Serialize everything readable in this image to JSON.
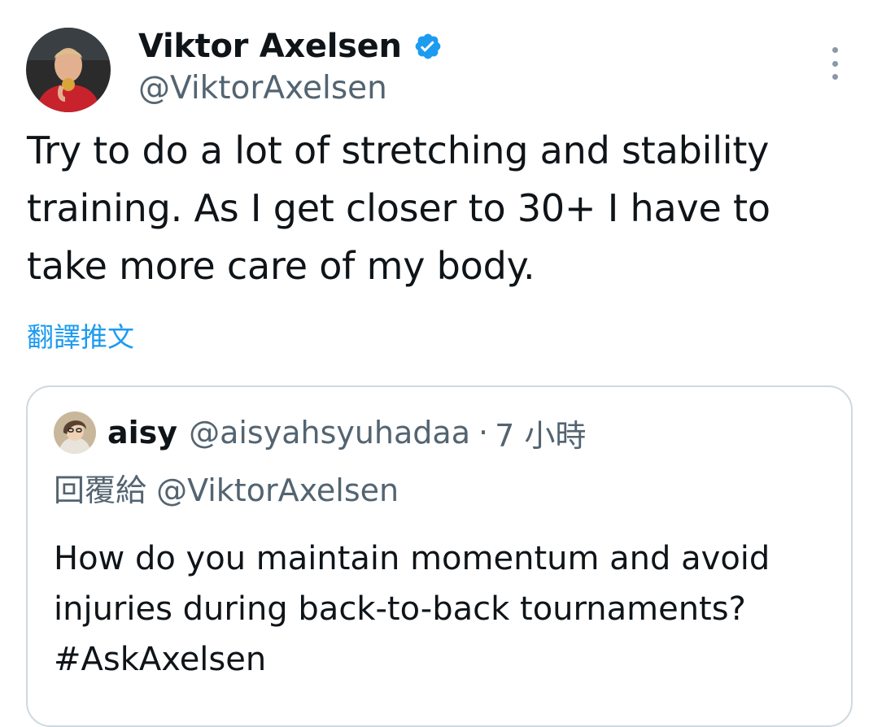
{
  "tweet": {
    "author": {
      "display_name": "Viktor Axelsen",
      "handle": "@ViktorAxelsen",
      "verified_icon": "verified-badge-icon",
      "avatar_icon": "user-avatar"
    },
    "more_icon": "more-options-icon",
    "text": "Try to do a lot of stretching and stability\ntraining. As I get closer to 30+ I have to\ntake more care of my body.",
    "translate_label": "翻譯推文"
  },
  "quote": {
    "author": {
      "display_name": "aisy",
      "handle": "@aisyahsyuhadaa",
      "avatar_icon": "user-avatar"
    },
    "separator": "·",
    "time": "7 小時",
    "reply_to": "回覆給 @ViktorAxelsen",
    "text": "How do you maintain momentum and avoid\ninjuries during back-to-back tournaments?\n#AskAxelsen"
  },
  "colors": {
    "text_primary": "#0f1419",
    "text_secondary": "#536471",
    "accent": "#1d9bf0",
    "border": "#cfd9de"
  }
}
